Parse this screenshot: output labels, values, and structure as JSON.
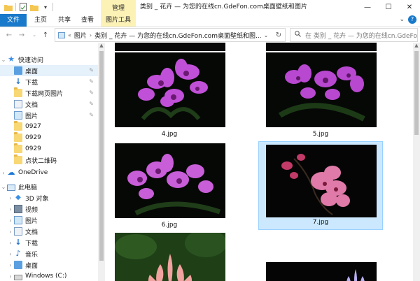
{
  "title_bar": {
    "window_title": "类别 _ 花卉 — 为您的在线cn.GdeFon.com桌面壁纸和图片",
    "context_tab_top": "管理",
    "minimize": "—",
    "maximize": "☐",
    "close": "✕"
  },
  "ribbon": {
    "tabs": [
      "文件",
      "主页",
      "共享",
      "查看",
      "图片工具"
    ]
  },
  "address": {
    "path": [
      "图片",
      "类别 _ 花卉 — 为您的在线cn.GdeFon.com桌面壁纸和图..."
    ],
    "search_placeholder": "在 类别 _ 花卉 — 为您的在线cn.GdeFon..."
  },
  "nav": {
    "items": [
      {
        "label": "快速访问",
        "icon": "star-icon"
      },
      {
        "label": "桌面",
        "icon": "desktop-folder-icon"
      },
      {
        "label": "下载",
        "icon": "download-icon"
      },
      {
        "label": "下载网页图片",
        "icon": "folder-icon"
      },
      {
        "label": "文档",
        "icon": "document-icon"
      },
      {
        "label": "图片",
        "icon": "pictures-icon"
      },
      {
        "label": "0927",
        "icon": "folder-icon"
      },
      {
        "label": "0929",
        "icon": "folder-icon"
      },
      {
        "label": "0929",
        "icon": "folder-icon"
      },
      {
        "label": "点状二维码",
        "icon": "folder-icon"
      },
      {
        "label": "OneDrive",
        "icon": "cloud-icon"
      },
      {
        "label": "此电脑",
        "icon": "computer-icon"
      },
      {
        "label": "3D 对象",
        "icon": "cube-icon"
      },
      {
        "label": "视频",
        "icon": "video-icon"
      },
      {
        "label": "图片",
        "icon": "pictures-icon"
      },
      {
        "label": "文档",
        "icon": "document-icon"
      },
      {
        "label": "下载",
        "icon": "download-icon"
      },
      {
        "label": "音乐",
        "icon": "music-icon"
      },
      {
        "label": "桌面",
        "icon": "desktop-folder-icon"
      },
      {
        "label": "Windows (C:)",
        "icon": "drive-icon"
      }
    ]
  },
  "files": [
    {
      "name": "",
      "variant": "dendrobium",
      "selected": false
    },
    {
      "name": "",
      "variant": "dendrobium",
      "selected": false
    },
    {
      "name": "4.jpg",
      "variant": "dendrobium",
      "selected": false
    },
    {
      "name": "5.jpg",
      "variant": "dendrobium",
      "selected": false
    },
    {
      "name": "6.jpg",
      "variant": "dendrobium",
      "selected": false
    },
    {
      "name": "7.jpg",
      "variant": "pink-orchid",
      "selected": true
    },
    {
      "name": "",
      "variant": "lotus",
      "selected": false
    },
    {
      "name": "",
      "variant": "water-lily",
      "selected": false
    }
  ],
  "colors": {
    "file_tab": "#1979ca",
    "context_tab": "#fdf2b6",
    "selection": "#cce8ff",
    "nav_selection": "#e5f1fb"
  }
}
